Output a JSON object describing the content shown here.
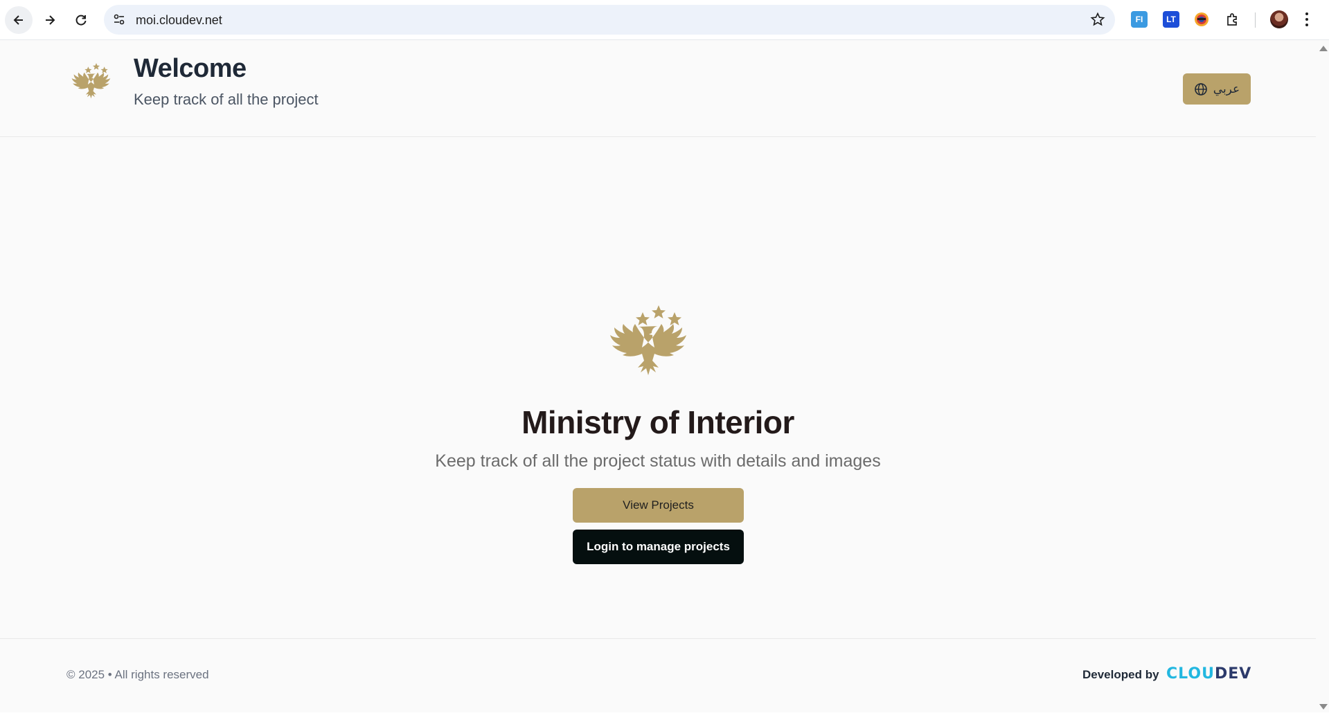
{
  "browser": {
    "url": "moi.cloudev.net",
    "extensions": [
      "FI",
      "LT"
    ]
  },
  "header": {
    "title": "Welcome",
    "subtitle": "Keep track of all the project",
    "language_button": "عربي"
  },
  "hero": {
    "title": "Ministry of Interior",
    "subtitle": "Keep track of all the project status with details and images",
    "view_projects_label": "View Projects",
    "login_label": "Login to manage projects"
  },
  "footer": {
    "copyright": "© 2025 • All rights reserved",
    "developed_by": "Developed by",
    "brand_part1": "CLOU",
    "brand_part2": "DEV"
  },
  "colors": {
    "gold": "#b9a26a",
    "dark_button": "#050f0f",
    "brand_cyan": "#22b7e0",
    "brand_navy": "#2c3a6b"
  },
  "icons": {
    "emblem": "eagle-emblem-icon",
    "language": "globe-icon"
  }
}
